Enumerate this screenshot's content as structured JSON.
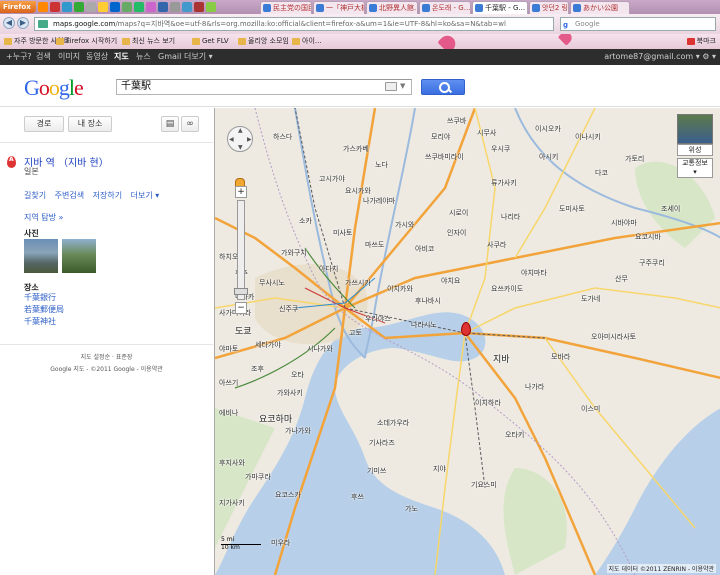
{
  "browser": {
    "firefox_button": "Firefox",
    "tabs": [
      {
        "label": "民主党の国民"
      },
      {
        "label": "一「神戸大橋 -"
      },
      {
        "label": "北野異人館..."
      },
      {
        "label": "온도래 - G..."
      },
      {
        "label": "千葉駅 - G...",
        "active": true
      },
      {
        "label": "앗던2 링"
      },
      {
        "label": "あかい公園"
      }
    ],
    "url_prefix": "maps.google.com",
    "url_rest": "/maps?q=지바역&oe=utf-8&rls=org.mozilla:ko:official&client=firefox-a&um=1&ie=UTF-8&hl=ko&sa=N&tab=wl",
    "search_placeholder": "Google",
    "bookmarks": [
      {
        "label": "자주 방문한 사이트"
      },
      {
        "label": "Firefox 시작하기"
      },
      {
        "label": "최신 뉴스 보기"
      },
      {
        "label": "Get FLV"
      },
      {
        "label": "올리앙 소모임"
      },
      {
        "label": "아이..."
      }
    ],
    "bookmarks_right": "북마크"
  },
  "gbar": {
    "items": [
      "+누구?",
      "검색",
      "이미지",
      "동영상",
      "지도",
      "뉴스",
      "Gmail",
      "더보기 ▾"
    ],
    "selected": "지도",
    "account": "artome87@gmail.com ▾",
    "settings": "⚙ ▾"
  },
  "header": {
    "logo_letters": [
      "G",
      "o",
      "o",
      "g",
      "l",
      "e"
    ],
    "query": "千葉駅"
  },
  "side": {
    "directions_btn": "경로",
    "mymaps_btn": "내 장소",
    "print_icon": "print-icon",
    "link_icon": "link-icon",
    "title": "지바 역 （지바 현）",
    "subtitle": "일본",
    "links": [
      "길찾기",
      "주변검색",
      "저장하기",
      "더보기 ▾"
    ],
    "nearby": "지역 탐방 »",
    "photos_heading": "사진",
    "places_heading": "장소",
    "places": [
      "千葉銀行",
      "若葉郵便局",
      "千葉神社"
    ],
    "footer1": "지도 설정순 · 표준장",
    "footer2": "Google 지도 - ©2011 Google - 이용약관"
  },
  "map": {
    "satellite": "위성",
    "traffic": "교통정보",
    "scale_top": "5 mi",
    "scale_bottom": "10 km",
    "copyright": "지도 데이터 ©2011 ZENRIN - 이용약관",
    "labels": [
      "하스다",
      "가스카베",
      "노다",
      "쓰쿠바미라이",
      "우시쿠",
      "류가사키",
      "아시키",
      "요시카와",
      "고시가야",
      "나가레야마",
      "소카",
      "미사토",
      "마쓰도",
      "가시와",
      "아비코",
      "인자이",
      "사쿠라",
      "나리타",
      "도미사토",
      "시로이",
      "가와구치",
      "아다치",
      "가쓰시카",
      "이치카와",
      "후나바시",
      "야치요",
      "요쓰카이도",
      "야치마타",
      "도쿄",
      "신주쿠",
      "세타가야",
      "시나가와",
      "오타",
      "고토",
      "가와사키",
      "우라야스",
      "나라시노",
      "지바",
      "이치하라",
      "기사라즈",
      "요코하마",
      "가나가와",
      "요코스카",
      "가마쿠라",
      "후지사와",
      "미우라",
      "소데가우라",
      "기미쓰",
      "후쓰",
      "가노",
      "오아미시라사토",
      "도가네",
      "산무",
      "모바라",
      "이스미",
      "오타키",
      "기요스미",
      "나가라",
      "지야",
      "구주쿠리",
      "시무사",
      "모리야",
      "쓰쿠바",
      "이시오카",
      "이나시키",
      "가토리",
      "다코",
      "시바야마",
      "요코시바",
      "조세이",
      "무사시노",
      "미타카",
      "조후",
      "하치오지",
      "후추",
      "사가미하라",
      "야마토",
      "아쓰기",
      "에비나",
      "지가사키"
    ]
  }
}
